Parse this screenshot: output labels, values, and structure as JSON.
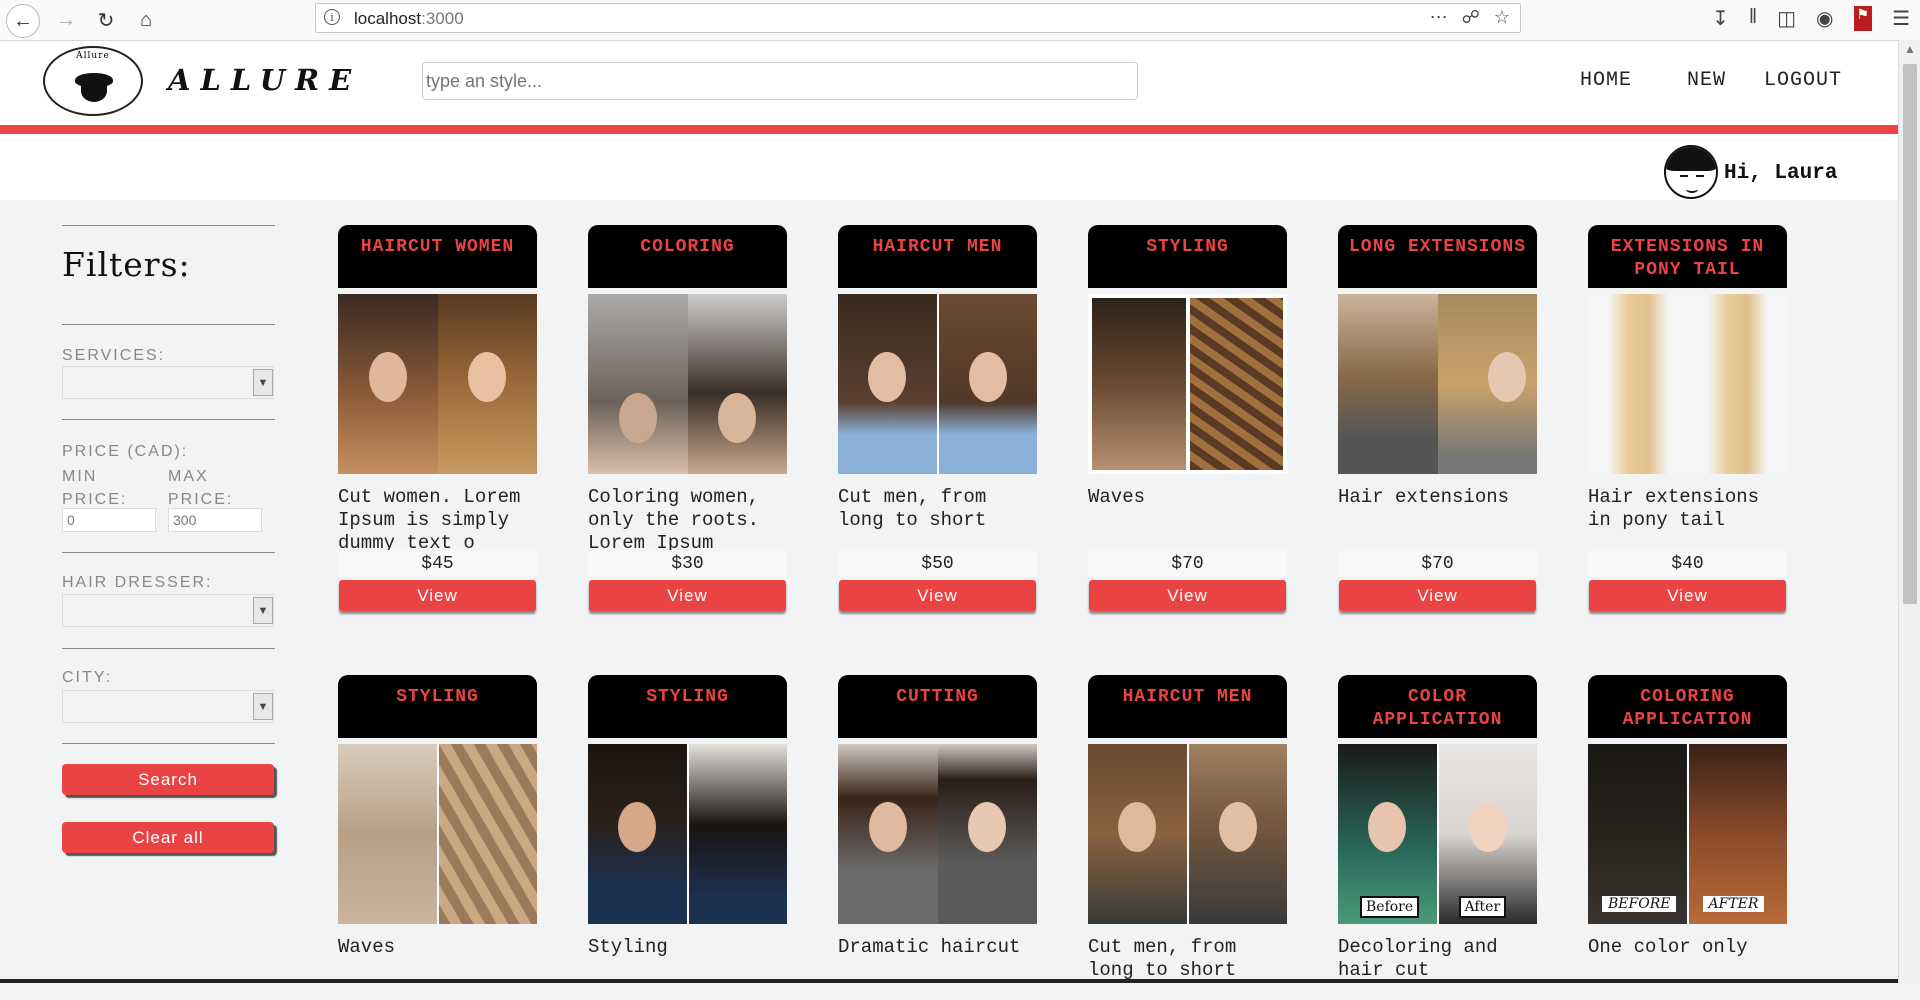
{
  "browser": {
    "url_host": "localhost",
    "url_port": ":3000",
    "icons": [
      "back-icon",
      "forward-icon",
      "reload-icon",
      "home-icon",
      "more-icon",
      "pocket-icon",
      "bookmark-star-icon",
      "download-icon",
      "library-icon",
      "sidebar-icon",
      "account-icon",
      "extension-icon",
      "menu-icon"
    ]
  },
  "header": {
    "brand": "ALLURE",
    "logo_top": "Allure",
    "search_placeholder": "type an style...",
    "menu": [
      "HOME",
      "NEW",
      "LOGOUT"
    ],
    "greeting": "Hi, Laura"
  },
  "filters": {
    "title": "Filters:",
    "services_label": "SERVICES:",
    "price_label": "PRICE (CAD):",
    "min_label": "MIN PRICE:",
    "max_label": "MAX PRICE:",
    "min_value": "0",
    "max_value": "300",
    "hairdresser_label": "HAIR DRESSER:",
    "city_label": "CITY:",
    "search_button": "Search",
    "clear_button": "Clear all"
  },
  "colors": {
    "accent": "#e94344",
    "card_head": "#000000"
  },
  "cards": [
    {
      "title": "HAIRCUT WOMEN",
      "desc": "Cut women. Lorem Ipsum is simply dummy text o",
      "price": "$45",
      "button": "View"
    },
    {
      "title": "COLORING",
      "desc": "Coloring women, only the roots. Lorem Ipsum",
      "price": "$30",
      "button": "View"
    },
    {
      "title": "HAIRCUT MEN",
      "desc": "Cut men, from long to short",
      "price": "$50",
      "button": "View"
    },
    {
      "title": "STYLING",
      "desc": "Waves",
      "price": "$70",
      "button": "View"
    },
    {
      "title": "LONG EXTENSIONS",
      "desc": "Hair extensions",
      "price": "$70",
      "button": "View"
    },
    {
      "title": "EXTENSIONS IN PONY TAIL",
      "desc": "Hair extensions in pony tail",
      "price": "$40",
      "button": "View"
    },
    {
      "title": "STYLING",
      "desc": "Waves"
    },
    {
      "title": "STYLING",
      "desc": "Styling"
    },
    {
      "title": "CUTTING",
      "desc": "Dramatic haircut"
    },
    {
      "title": "HAIRCUT MEN",
      "desc": "Cut men, from long to short"
    },
    {
      "title": "COLOR APPLICATION",
      "desc": "Decoloring and hair cut",
      "tag_left": "Before",
      "tag_right": "After"
    },
    {
      "title": "COLORING APPLICATION",
      "desc": "One color only",
      "tag_left": "BEFORE",
      "tag_right": "AFTER"
    }
  ]
}
